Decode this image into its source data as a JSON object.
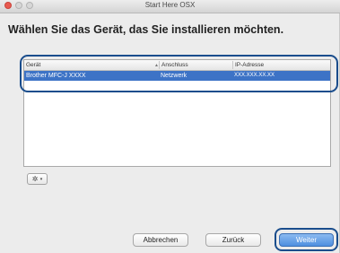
{
  "window": {
    "title": "Start Here OSX"
  },
  "heading": "Wählen Sie das Gerät, das Sie installieren möchten.",
  "table": {
    "columns": [
      "Gerät",
      "Anschluss",
      "IP-Adresse"
    ],
    "rows": [
      {
        "device": "Brother MFC-J XXXX",
        "connection": "Netzwerk",
        "ip": "XXX.XXX.XX.XX",
        "selected": true
      }
    ]
  },
  "gear_menu": {
    "icon": "gear-icon",
    "caret": "▾"
  },
  "buttons": {
    "cancel": "Abbrechen",
    "back": "Zurück",
    "next": "Weiter"
  },
  "colors": {
    "selection": "#3d73c6",
    "callout": "#1a4d8c",
    "primary_button": "#4e8fe0",
    "close_button": "#e85b51"
  }
}
